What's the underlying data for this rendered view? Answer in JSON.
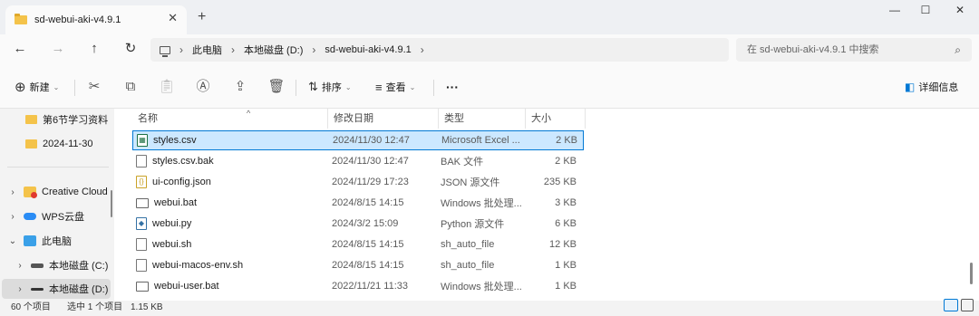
{
  "window": {
    "tab_title": "sd-webui-aki-v4.9.1",
    "tab_close": "✕",
    "new_tab": "+",
    "minimize": "—",
    "maximize": "☐",
    "close": "✕"
  },
  "nav": {
    "back": "←",
    "forward": "→",
    "up": "↑",
    "refresh": "↻",
    "breadcrumbs": [
      "此电脑",
      "本地磁盘 (D:)",
      "sd-webui-aki-v4.9.1"
    ],
    "crumb_sep": "›",
    "search_placeholder": "在 sd-webui-aki-v4.9.1 中搜索",
    "search_icon": "⌕"
  },
  "toolbar": {
    "new_label": "新建",
    "sort_label": "排序",
    "view_label": "查看",
    "more": "···",
    "details_label": "详细信息",
    "icons": [
      "cut-icon",
      "copy-icon",
      "paste-icon",
      "rename-icon",
      "share-icon",
      "delete-icon"
    ]
  },
  "sidebar": {
    "items": [
      {
        "label": "第6节学习资料",
        "type": "folder"
      },
      {
        "label": "2024-11-30",
        "type": "folder"
      },
      {
        "label": "Creative Cloud",
        "type": "cloud"
      },
      {
        "label": "WPS云盘",
        "type": "cloud"
      },
      {
        "label": "此电脑",
        "type": "pc"
      },
      {
        "label": "本地磁盘 (C:)",
        "type": "drive"
      },
      {
        "label": "本地磁盘 (D:)",
        "type": "drive"
      }
    ]
  },
  "columns": {
    "name": "名称",
    "date": "修改日期",
    "type": "类型",
    "size": "大小"
  },
  "files": [
    {
      "name": "styles.csv",
      "date": "2024/11/30 12:47",
      "type": "Microsoft Excel ...",
      "size": "2 KB",
      "icon": "csv",
      "selected": true
    },
    {
      "name": "styles.csv.bak",
      "date": "2024/11/30 12:47",
      "type": "BAK 文件",
      "size": "2 KB",
      "icon": "file"
    },
    {
      "name": "ui-config.json",
      "date": "2024/11/29 17:23",
      "type": "JSON 源文件",
      "size": "235 KB",
      "icon": "json"
    },
    {
      "name": "webui.bat",
      "date": "2024/8/15 14:15",
      "type": "Windows 批处理...",
      "size": "3 KB",
      "icon": "bat"
    },
    {
      "name": "webui.py",
      "date": "2024/3/2 15:09",
      "type": "Python 源文件",
      "size": "6 KB",
      "icon": "py"
    },
    {
      "name": "webui.sh",
      "date": "2024/8/15 14:15",
      "type": "sh_auto_file",
      "size": "12 KB",
      "icon": "file"
    },
    {
      "name": "webui-macos-env.sh",
      "date": "2024/8/15 14:15",
      "type": "sh_auto_file",
      "size": "1 KB",
      "icon": "file"
    },
    {
      "name": "webui-user.bat",
      "date": "2022/11/21 11:33",
      "type": "Windows 批处理...",
      "size": "1 KB",
      "icon": "bat"
    }
  ],
  "status": {
    "item_count": "60 个项目",
    "selected": "选中 1 个项目",
    "size": "1.15 KB"
  },
  "colors": {
    "accent": "#0078d4",
    "selection": "#cce8ff",
    "folder": "#f4c34a"
  }
}
